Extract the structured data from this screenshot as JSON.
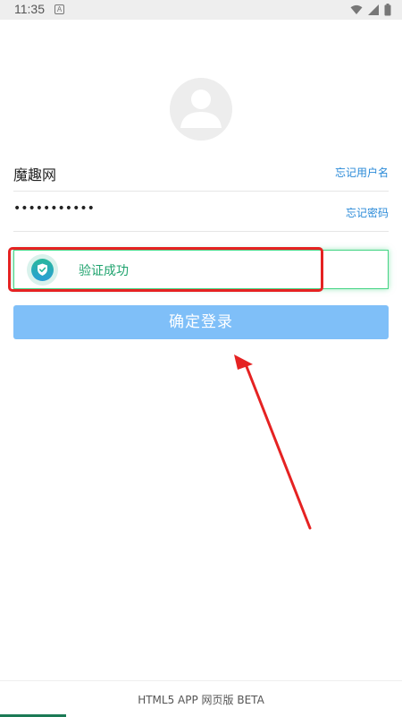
{
  "status_bar": {
    "time": "11:35",
    "notification_letter": "A",
    "icons": [
      "wifi-icon",
      "signal-icon",
      "battery-icon"
    ]
  },
  "login": {
    "username": "魔趣网",
    "forgot_username": "忘记用户名",
    "password_masked": "•••••••••••",
    "forgot_password": "忘记密码",
    "verify_text": "验证成功",
    "submit_label": "确定登录"
  },
  "footer": {
    "text": "HTML5 APP 网页版 BETA"
  },
  "colors": {
    "link": "#2a8ad8",
    "verify_success": "#1fa36e",
    "verify_border": "#45d485",
    "button_bg": "#7fbff8",
    "annotation_red": "#e52222"
  }
}
